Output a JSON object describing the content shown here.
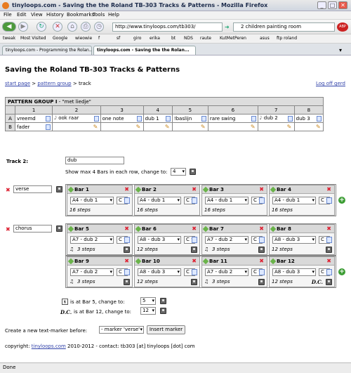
{
  "window": {
    "title": "tinyloops.com - Saving the the Roland TB-303 Tracks & Patterns - Mozilla Firefox",
    "min": "_",
    "max": "□",
    "close": "✕"
  },
  "menu": [
    "File",
    "Edit",
    "View",
    "History",
    "Bookmarks",
    "Tools",
    "Help"
  ],
  "nav": {
    "url": "http://www.tinyloops.com/tb303/",
    "search": "2 children painting room"
  },
  "bookmarks": [
    "tweak",
    "Most Visited",
    "Google",
    "wieowie",
    "f",
    "sf",
    "giro",
    "erika",
    "bt",
    "NDS",
    "raute",
    "KutMetPeren",
    "asus",
    "ftp roland"
  ],
  "tabs": [
    {
      "label": "tinyloops.com - Programming the Rolan..."
    },
    {
      "label": "tinyloops.com - Saving the the Rolan..."
    }
  ],
  "page": {
    "heading": "Saving the Roland TB-303 Tracks & Patterns",
    "crumbs": {
      "start": "start page",
      "sep1": " > ",
      "group": "pattern group",
      "sep2": " > ",
      "current": "track"
    },
    "logoff": "Log off gerd"
  },
  "pattern_group": {
    "title": "PATTERN GROUP I",
    "subtitle": " - \"met liedje\"",
    "columns": [
      "1",
      "2",
      "3",
      "4",
      "5",
      "6",
      "7",
      "8"
    ],
    "rows": [
      {
        "label": "A",
        "cells": [
          "vreemd",
          "ook raar",
          "one note",
          "dub 1",
          "!baslijn",
          "rare swing",
          "dub 2",
          "dub 3"
        ]
      },
      {
        "label": "B",
        "cells": [
          "fader",
          "",
          "",
          "",
          "",
          "",
          "",
          ""
        ]
      }
    ]
  },
  "track": {
    "label": "Track 2:",
    "name": "dub",
    "show_max_label": "Show max 4 Bars in each row, change to:",
    "show_max_value": "4"
  },
  "sections": [
    {
      "marker": "verse",
      "rows": [
        [
          {
            "title": "Bar 1",
            "pattern": "A4 - dub 1",
            "key": "C",
            "steps": "16 steps",
            "triplet": false,
            "dc": ""
          },
          {
            "title": "Bar 2",
            "pattern": "A4 - dub 1",
            "key": "C",
            "steps": "16 steps",
            "triplet": false,
            "dc": ""
          },
          {
            "title": "Bar 3",
            "pattern": "A4 - dub 1",
            "key": "C",
            "steps": "16 steps",
            "triplet": false,
            "dc": ""
          },
          {
            "title": "Bar 4",
            "pattern": "A4 - dub 1",
            "key": "C",
            "steps": "16 steps",
            "triplet": false,
            "dc": ""
          }
        ]
      ]
    },
    {
      "marker": "chorus",
      "rows": [
        [
          {
            "title": "Bar 5",
            "pattern": "A7 - dub 2",
            "key": "C",
            "steps": "3 steps",
            "triplet": true,
            "dc": ""
          },
          {
            "title": "Bar 6",
            "pattern": "A8 - dub 3",
            "key": "C",
            "steps": "12 steps",
            "triplet": false,
            "dc": ""
          },
          {
            "title": "Bar 7",
            "pattern": "A7 - dub 2",
            "key": "C",
            "steps": "3 steps",
            "triplet": true,
            "dc": ""
          },
          {
            "title": "Bar 8",
            "pattern": "A8 - dub 3",
            "key": "C",
            "steps": "12 steps",
            "triplet": false,
            "dc": ""
          }
        ],
        [
          {
            "title": "Bar 9",
            "pattern": "A7 - dub 2",
            "key": "C",
            "steps": "3 steps",
            "triplet": true,
            "dc": ""
          },
          {
            "title": "Bar 10",
            "pattern": "A8 - dub 3",
            "key": "C",
            "steps": "12 steps",
            "triplet": false,
            "dc": ""
          },
          {
            "title": "Bar 11",
            "pattern": "A7 - dub 2",
            "key": "C",
            "steps": "3 steps",
            "triplet": true,
            "dc": ""
          },
          {
            "title": "Bar 12",
            "pattern": "A8 - dub 3",
            "key": "C",
            "steps": "12 steps",
            "triplet": false,
            "dc": "D.C."
          }
        ]
      ]
    }
  ],
  "segno": {
    "label": "is at Bar 5, change to:",
    "value": "5"
  },
  "dc": {
    "sym": "D.C.",
    "label": "is at Bar 12, change to:",
    "value": "12"
  },
  "marker_form": {
    "label": "Create a new text-marker before:",
    "select": "- marker 'verse'",
    "button": "Insert marker"
  },
  "footer": {
    "prefix": "copyright: ",
    "link": "tinyloops.com",
    "rest": " 2010-2012 - contact: tb303 [at] tinyloops [dot] com"
  },
  "status": "Done",
  "colors": {
    "link": "#3344aa",
    "delete": "#dd2233",
    "add": "#3c9d34"
  }
}
